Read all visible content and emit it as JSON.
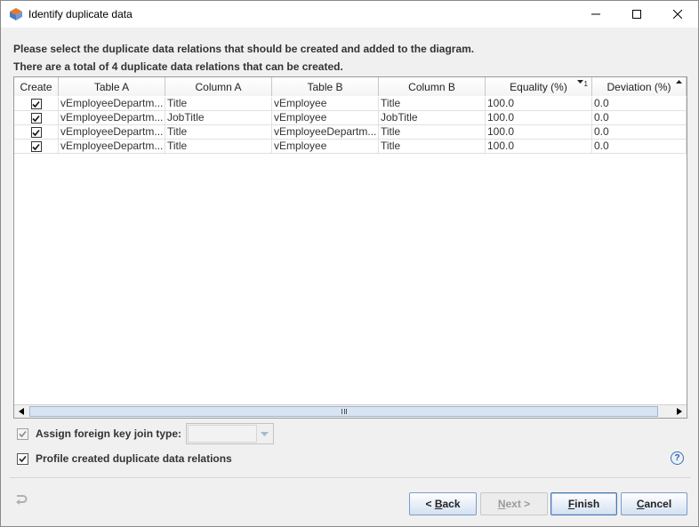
{
  "window": {
    "title": "Identify duplicate data"
  },
  "instructions": {
    "line1": "Please select the duplicate data relations that should be created and added to the diagram.",
    "line2": "There are a total of 4 duplicate data relations that can be created."
  },
  "table": {
    "columns": [
      {
        "label": "Create",
        "width": 50
      },
      {
        "label": "Table A",
        "width": 120
      },
      {
        "label": "Column A",
        "width": 120
      },
      {
        "label": "Table B",
        "width": 120
      },
      {
        "label": "Column B",
        "width": 120
      },
      {
        "label": "Equality (%)",
        "width": 120,
        "sort": "descending",
        "sort_order": "1"
      },
      {
        "label": "Deviation (%)",
        "width": 106,
        "sort": "ascending"
      }
    ],
    "rows": [
      {
        "create": true,
        "table_a": "vEmployeeDepartm...",
        "column_a": "Title",
        "table_b": "vEmployee",
        "column_b": "Title",
        "equality": "100.0",
        "deviation": "0.0"
      },
      {
        "create": true,
        "table_a": "vEmployeeDepartm...",
        "column_a": "JobTitle",
        "table_b": "vEmployee",
        "column_b": "JobTitle",
        "equality": "100.0",
        "deviation": "0.0"
      },
      {
        "create": true,
        "table_a": "vEmployeeDepartm...",
        "column_a": "Title",
        "table_b": "vEmployeeDepartm...",
        "column_b": "Title",
        "equality": "100.0",
        "deviation": "0.0"
      },
      {
        "create": true,
        "table_a": "vEmployeeDepartm...",
        "column_a": "Title",
        "table_b": "vEmployee",
        "column_b": "Title",
        "equality": "100.0",
        "deviation": "0.0"
      }
    ]
  },
  "options": {
    "assign_fk_label": "Assign foreign key join type:",
    "assign_fk_checked": true,
    "assign_fk_enabled": false,
    "join_type_value": "",
    "profile_label": "Profile created duplicate data relations",
    "profile_checked": true
  },
  "buttons": {
    "back": {
      "prefix": "< ",
      "mnemonic": "B",
      "rest": "ack"
    },
    "next": {
      "mnemonic": "N",
      "rest": "ext >"
    },
    "finish": {
      "mnemonic": "F",
      "rest": "inish"
    },
    "cancel": {
      "mnemonic": "C",
      "rest": "ancel"
    }
  },
  "colors": {
    "accent": "#3d6fb3",
    "button_border": "#7a9cc8"
  }
}
